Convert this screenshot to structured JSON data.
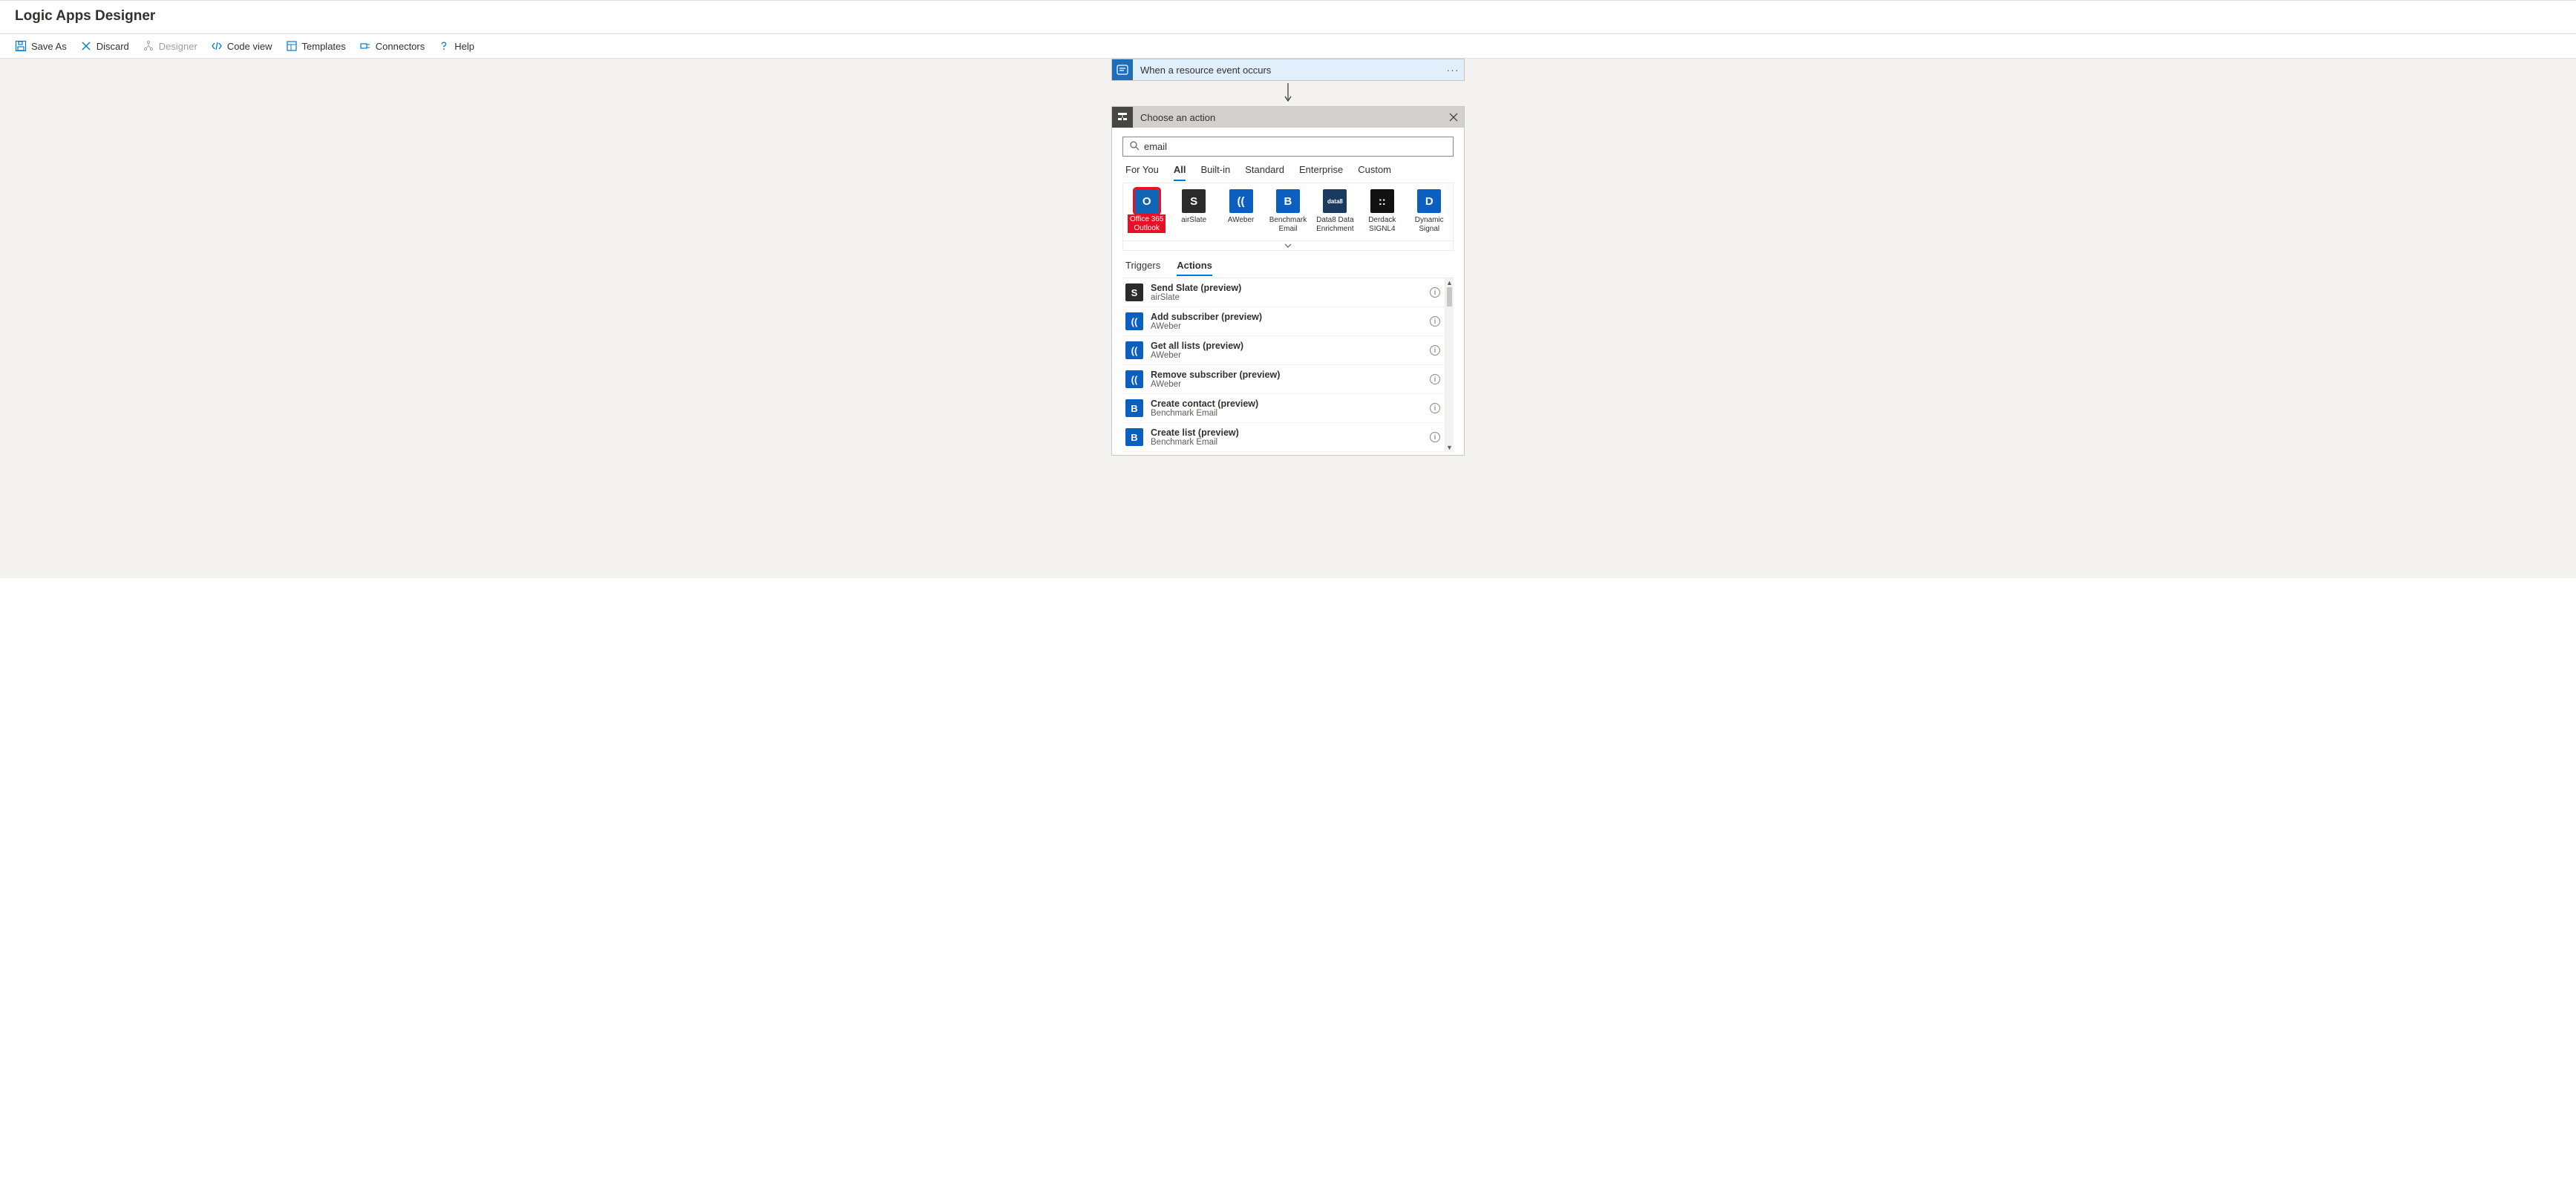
{
  "page_title": "Logic Apps Designer",
  "toolbar": {
    "save_as": "Save As",
    "discard": "Discard",
    "designer": "Designer",
    "code_view": "Code view",
    "templates": "Templates",
    "connectors": "Connectors",
    "help": "Help"
  },
  "trigger": {
    "label": "When a resource event occurs",
    "more": "···"
  },
  "action_panel": {
    "header": "Choose an action",
    "search_value": "email",
    "scope_tabs": [
      "For You",
      "All",
      "Built-in",
      "Standard",
      "Enterprise",
      "Custom"
    ],
    "scope_active": "All",
    "connectors": [
      {
        "label": "Office 365 Outlook",
        "bg": "#1066b5",
        "glyph": "O",
        "highlighted": true
      },
      {
        "label": "airSlate",
        "bg": "#2b2b2b",
        "glyph": "S"
      },
      {
        "label": "AWeber",
        "bg": "#0a5fc0",
        "glyph": "(("
      },
      {
        "label": "Benchmark Email",
        "bg": "#0a5fc0",
        "glyph": "B"
      },
      {
        "label": "Data8 Data Enrichment",
        "bg": "#1a3a5f",
        "glyph": "data8"
      },
      {
        "label": "Derdack SIGNL4",
        "bg": "#111111",
        "glyph": "::"
      },
      {
        "label": "Dynamic Signal",
        "bg": "#0a5fc0",
        "glyph": "D"
      }
    ],
    "ta_tabs": [
      "Triggers",
      "Actions"
    ],
    "ta_active": "Actions",
    "actions": [
      {
        "title": "Send Slate (preview)",
        "sub": "airSlate",
        "bg": "#2b2b2b",
        "glyph": "S"
      },
      {
        "title": "Add subscriber (preview)",
        "sub": "AWeber",
        "bg": "#0a5fc0",
        "glyph": "(("
      },
      {
        "title": "Get all lists (preview)",
        "sub": "AWeber",
        "bg": "#0a5fc0",
        "glyph": "(("
      },
      {
        "title": "Remove subscriber (preview)",
        "sub": "AWeber",
        "bg": "#0a5fc0",
        "glyph": "(("
      },
      {
        "title": "Create contact (preview)",
        "sub": "Benchmark Email",
        "bg": "#0a5fc0",
        "glyph": "B"
      },
      {
        "title": "Create list (preview)",
        "sub": "Benchmark Email",
        "bg": "#0a5fc0",
        "glyph": "B"
      }
    ]
  }
}
